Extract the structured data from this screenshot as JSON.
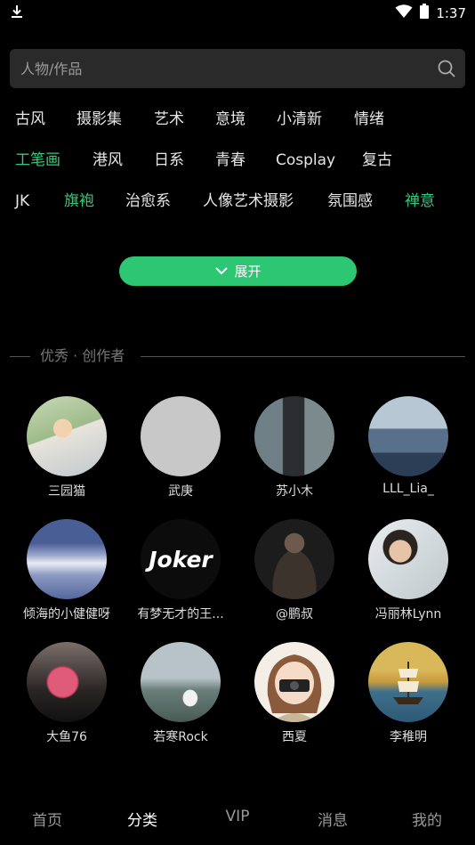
{
  "status": {
    "time": "1:37"
  },
  "search": {
    "placeholder": "人物/作品"
  },
  "tags": {
    "row1": [
      "古风",
      "摄影集",
      "艺术",
      "意境",
      "小清新",
      "情绪"
    ],
    "row2": [
      "工笔画",
      "港风",
      "日系",
      "青春",
      "Cosplay",
      "复古"
    ],
    "row3": [
      "JK",
      "旗袍",
      "治愈系",
      "人像艺术摄影",
      "氛围感",
      "禅意"
    ]
  },
  "expand_label": "展开",
  "section_title": "优秀 · 创作者",
  "creators": [
    "三园猫",
    "武庚",
    "苏小木",
    "LLL_Lia_",
    "倾海的小健健呀",
    "有梦无才的王...",
    "@鹏叔",
    "冯丽林Lynn",
    "大鱼76",
    "若寒Rock",
    "西夏",
    "李稚明"
  ],
  "joker_text": "Joker",
  "tabs": [
    "首页",
    "分类",
    "VIP",
    "消息",
    "我的"
  ],
  "colors": {
    "accent": "#2dc673",
    "tag_highlight": "#35c97a",
    "background": "#000000"
  }
}
